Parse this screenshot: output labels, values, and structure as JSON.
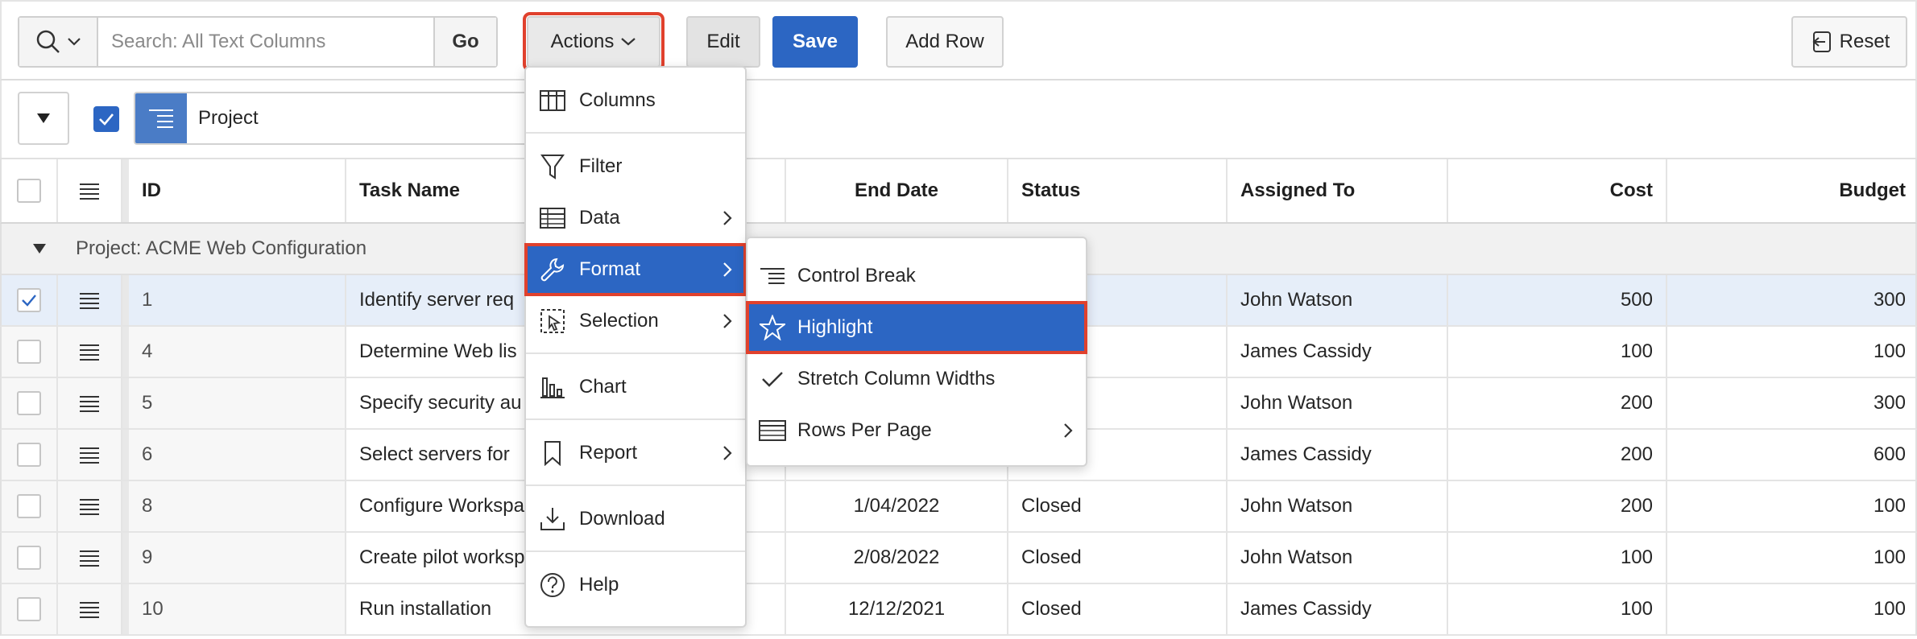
{
  "toolbar": {
    "search_placeholder": "Search: All Text Columns",
    "go_label": "Go",
    "actions_label": "Actions",
    "edit_label": "Edit",
    "save_label": "Save",
    "add_row_label": "Add Row",
    "reset_label": "Reset"
  },
  "control_break": {
    "label": "Project",
    "checked": true
  },
  "columns": {
    "id": "ID",
    "task_name": "Task Name",
    "end_date": "End Date",
    "status": "Status",
    "assigned_to": "Assigned To",
    "cost": "Cost",
    "budget": "Budget"
  },
  "group": {
    "label": "Project: ACME Web Configuration"
  },
  "rows": [
    {
      "id": "1",
      "task": "Identify server req",
      "end_date": "",
      "status": "",
      "assigned": "John Watson",
      "cost": "500",
      "budget": "300",
      "selected": true
    },
    {
      "id": "4",
      "task": "Determine Web lis",
      "end_date": "",
      "status": "",
      "assigned": "James Cassidy",
      "cost": "100",
      "budget": "100",
      "selected": false
    },
    {
      "id": "5",
      "task": "Specify security au",
      "end_date": "",
      "status": "",
      "assigned": "John Watson",
      "cost": "200",
      "budget": "300",
      "selected": false
    },
    {
      "id": "6",
      "task": "Select servers for",
      "end_date": "",
      "status": "",
      "assigned": "James Cassidy",
      "cost": "200",
      "budget": "600",
      "selected": false
    },
    {
      "id": "8",
      "task": "Configure Workspa",
      "end_date": "1/04/2022",
      "status": "Closed",
      "assigned": "John Watson",
      "cost": "200",
      "budget": "100",
      "selected": false
    },
    {
      "id": "9",
      "task": "Create pilot worksp",
      "end_date": "2/08/2022",
      "status": "Closed",
      "assigned": "John Watson",
      "cost": "100",
      "budget": "100",
      "selected": false
    },
    {
      "id": "10",
      "task": "Run installation",
      "end_date": "12/12/2021",
      "status": "Closed",
      "assigned": "James Cassidy",
      "cost": "100",
      "budget": "100",
      "selected": false
    }
  ],
  "actions_menu": {
    "items": [
      {
        "label": "Columns",
        "icon": "columns-icon",
        "submenu": false
      },
      {
        "label": "Filter",
        "icon": "filter-icon",
        "submenu": false
      },
      {
        "label": "Data",
        "icon": "data-table-icon",
        "submenu": true
      },
      {
        "label": "Format",
        "icon": "wrench-icon",
        "submenu": true,
        "active": true
      },
      {
        "label": "Selection",
        "icon": "selection-icon",
        "submenu": true
      },
      {
        "label": "Chart",
        "icon": "bar-chart-icon",
        "submenu": false
      },
      {
        "label": "Report",
        "icon": "bookmark-icon",
        "submenu": true
      },
      {
        "label": "Download",
        "icon": "download-icon",
        "submenu": false
      },
      {
        "label": "Help",
        "icon": "help-icon",
        "submenu": false
      }
    ]
  },
  "format_menu": {
    "items": [
      {
        "label": "Control Break",
        "icon": "control-break-icon",
        "submenu": false
      },
      {
        "label": "Highlight",
        "icon": "star-icon",
        "submenu": false,
        "active": true
      },
      {
        "label": "Stretch Column Widths",
        "icon": "check-icon",
        "submenu": false
      },
      {
        "label": "Rows Per Page",
        "icon": "rows-icon",
        "submenu": true
      }
    ]
  },
  "colors": {
    "accent": "#2c66c3",
    "highlight_outline": "#e0412d",
    "selected_row": "#e6eef9"
  }
}
